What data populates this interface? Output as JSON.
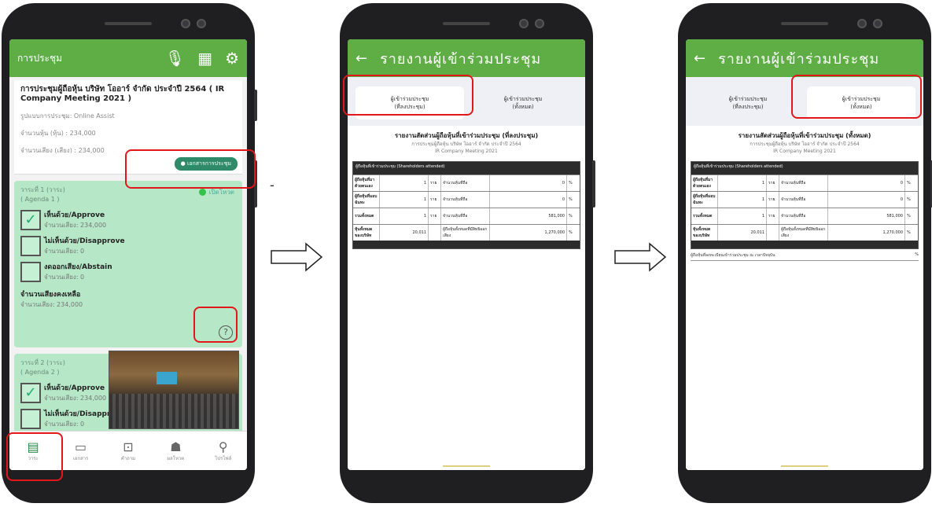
{
  "phone1": {
    "appbar_title": "การประชุม",
    "meeting": {
      "title": "การประชุมผู้ถือหุ้น บริษัท โออาร์ จำกัด ประจำปี 2564 ( IR Company Meeting 2021 )",
      "line1": "รูปแบบการประชุม: Online Assist",
      "line2": "จำนวนหุ้น (หุ้น) : 234,000",
      "line3": "จำนวนเสียง (เสียง) : 234,000",
      "doc_button": "เอกสารการประชุม"
    },
    "agenda1": {
      "title": "วาระที่ 1 (วาระ)",
      "subtitle": "( Agenda 1 )",
      "status": "เปิดโหวต",
      "options": [
        {
          "label": "เห็นด้วย/Approve",
          "count": "จำนวนเสียง: 234,000"
        },
        {
          "label": "ไม่เห็นด้วย/Disapprove",
          "count": "จำนวนเสียง: 0"
        },
        {
          "label": "งดออกเสียง/Abstain",
          "count": "จำนวนเสียง: 0"
        }
      ],
      "not_voted": "จำนวนเสียงคงเหลือ",
      "not_voted_count": "จำนวนเสียง: 234,000",
      "help": "?"
    },
    "agenda2": {
      "title": "วาระที่ 2 (วาระ)",
      "subtitle": "( Agenda 2 )",
      "options": [
        {
          "label": "เห็นด้วย/Approve",
          "count": "จำนวนเสียง: 234,000"
        },
        {
          "label": "ไม่เห็นด้วย/Disapprove",
          "count": "จำนวนเสียง: 0"
        }
      ]
    },
    "nav": [
      {
        "icon": "▤",
        "label": "วาระ"
      },
      {
        "icon": "▭",
        "label": "เอกสาร"
      },
      {
        "icon": "⊡",
        "label": "คำถาม"
      },
      {
        "icon": "☗",
        "label": "ผลโหวต"
      },
      {
        "icon": "⚲",
        "label": "โปรไฟล์"
      }
    ]
  },
  "report": {
    "title": "รายงานผู้เข้าร่วมประชุม",
    "tab_left": "ผู้เข้าร่วมประชุม\n(ที่ลงประชุม)",
    "tab_right": "ผู้เข้าร่วมประชุม\n(ทั้งหมด)",
    "heading2": "รายงานสัดส่วนผู้ถือหุ้นที่เข้าร่วมประชุม (ที่ลงประชุม)",
    "heading3": "รายงานสัดส่วนผู้ถือหุ้นที่เข้าร่วมประชุม (ทั้งหมด)",
    "sub1": "การประชุมผู้ถือหุ้น บริษัท โออาร์ จำกัด ประจำปี 2564",
    "sub2": "IR Company Meeting 2021",
    "table_header": "ผู้ถือหุ้นที่เข้าร่วมประชุม (Shareholders attended)",
    "rows": [
      {
        "label": "ผู้ถือหุ้นที่มาด้วยตนเอง",
        "value": "1",
        "unit": "ราย",
        "desc": "จำนวนหุ้นที่ถือ",
        "shares": "0",
        "pct": "%"
      },
      {
        "label": "ผู้ถือหุ้นที่มอบฉันทะ",
        "value": "1",
        "unit": "ราย",
        "desc": "จำนวนหุ้นที่ถือ",
        "shares": "0",
        "pct": "%"
      },
      {
        "label": "รวมทั้งหมด",
        "value": "1",
        "unit": "ราย",
        "desc": "จำนวนหุ้นที่ถือ",
        "shares": "581,000",
        "pct": "%"
      },
      {
        "label": "หุ้นทั้งหมดของบริษัท",
        "value": "20,011",
        "unit": "",
        "desc": "ผู้ถือหุ้นทั้งหมดที่มีสิทธิออกเสียง",
        "shares": "1,270,000",
        "pct": "%"
      }
    ],
    "note": "ผู้ถือหุ้นที่ลงทะเบียนเข้าร่วมประชุม ณ เวลาปัจจุบัน",
    "note_pct": "%"
  }
}
